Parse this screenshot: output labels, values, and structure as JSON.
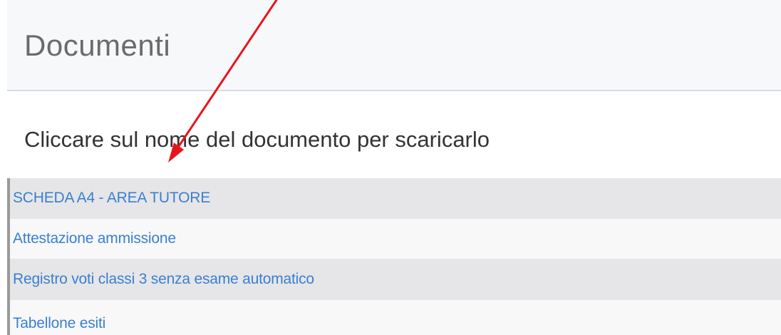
{
  "header": {
    "title": "Documenti"
  },
  "instruction": "Cliccare sul nome del documento per scaricarlo",
  "documents": [
    {
      "label": "SCHEDA A4 - AREA TUTORE"
    },
    {
      "label": "Attestazione ammissione"
    },
    {
      "label": "Registro voti classi 3 senza esame automatico"
    },
    {
      "label": "Tabellone esiti"
    }
  ],
  "colors": {
    "link": "#3a7fd0",
    "annotation_arrow": "#e8141c",
    "row_shaded": "#e6e6e8",
    "header_bg": "#f7f8fa"
  },
  "annotation": {
    "type": "arrow",
    "icon": "red-arrow-icon",
    "points_to": "document list"
  }
}
